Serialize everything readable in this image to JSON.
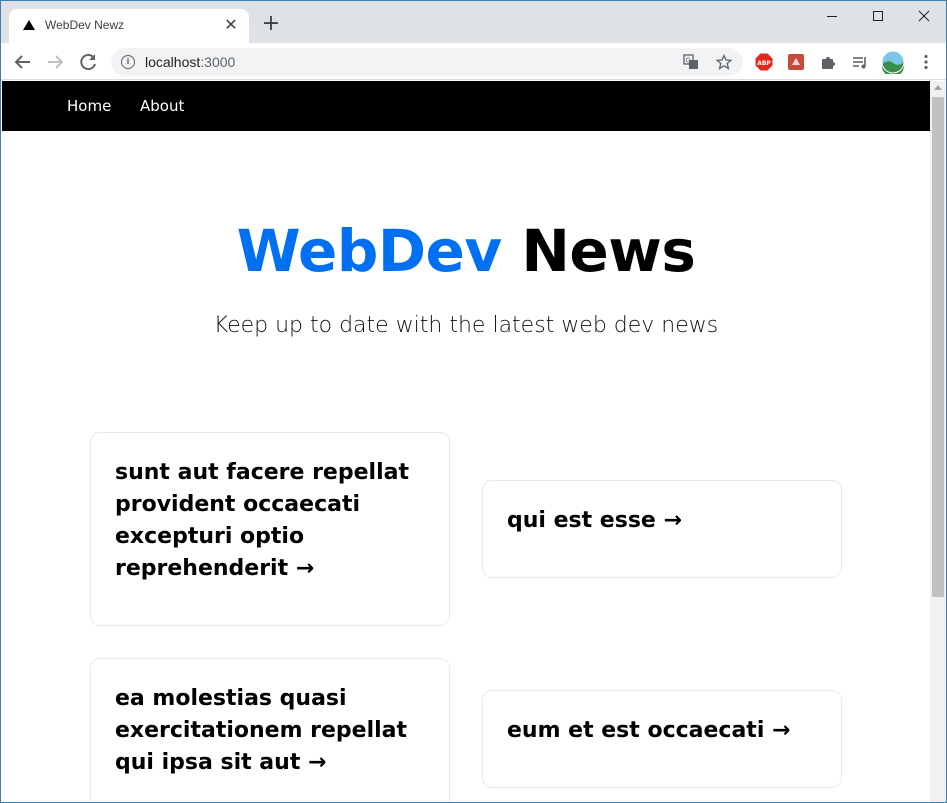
{
  "browser": {
    "tab_title": "WebDev Newz",
    "url_host": "localhost",
    "url_port": ":3000",
    "icons": [
      "triangle-favicon",
      "close-icon",
      "plus-icon",
      "back-icon",
      "forward-icon",
      "reload-icon",
      "info-icon",
      "translate-icon",
      "star-icon",
      "abp-extension-icon",
      "red-extension-icon",
      "puzzle-icon",
      "playlist-icon",
      "profile-avatar"
    ],
    "abp_label": "ABP"
  },
  "nav": {
    "items": [
      "Home",
      "About"
    ]
  },
  "hero": {
    "title_accent": "WebDev",
    "title_rest": "News",
    "subtitle": "Keep up to date with the latest web dev news",
    "accent_color": "#0070f3"
  },
  "articles": [
    {
      "title": "sunt aut facere repellat provident occaecati excepturi optio reprehenderit →"
    },
    {
      "title": "qui est esse →"
    },
    {
      "title": "ea molestias quasi exercitationem repellat qui ipsa sit aut →"
    },
    {
      "title": "eum et est occaecati →"
    }
  ]
}
